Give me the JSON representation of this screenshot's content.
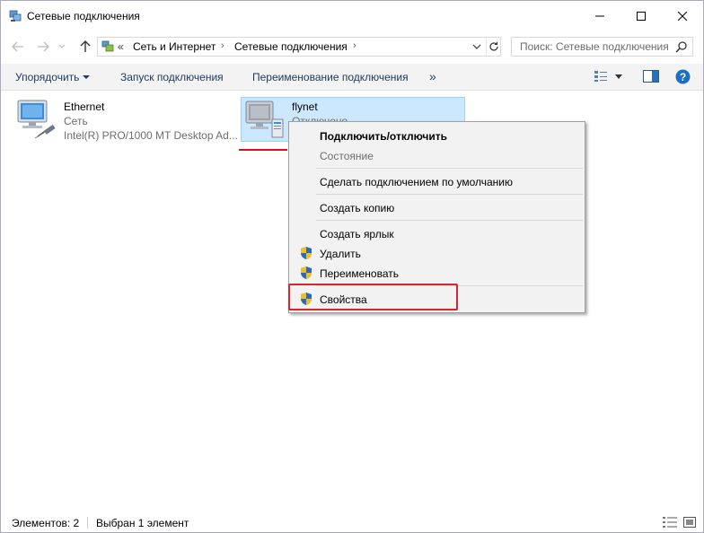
{
  "window": {
    "title": "Сетевые подключения",
    "icon": "network-connections-icon"
  },
  "address": {
    "overflow": "«",
    "crumbs": [
      "Сеть и Интернет",
      "Сетевые подключения"
    ],
    "search_placeholder": "Поиск: Сетевые подключения"
  },
  "commands": {
    "organize": "Упорядочить",
    "start_connection": "Запуск подключения",
    "rename_connection": "Переименование подключения",
    "more": "»"
  },
  "items": [
    {
      "name": "Ethernet",
      "status": "Сеть",
      "device": "Intel(R) PRO/1000 MT Desktop Ad..."
    },
    {
      "name": "flynet",
      "status": "Отключено"
    }
  ],
  "context_menu": {
    "connect_disconnect": "Подключить/отключить",
    "status": "Состояние",
    "set_default": "Сделать подключением по умолчанию",
    "create_copy": "Создать копию",
    "create_shortcut": "Создать ярлык",
    "delete": "Удалить",
    "rename": "Переименовать",
    "properties": "Свойства"
  },
  "statusbar": {
    "items_count": "Элементов: 2",
    "selected": "Выбран 1 элемент"
  },
  "colors": {
    "accent": "#0078d7",
    "selection": "#cce8ff",
    "highlight_red": "#d4262c"
  }
}
